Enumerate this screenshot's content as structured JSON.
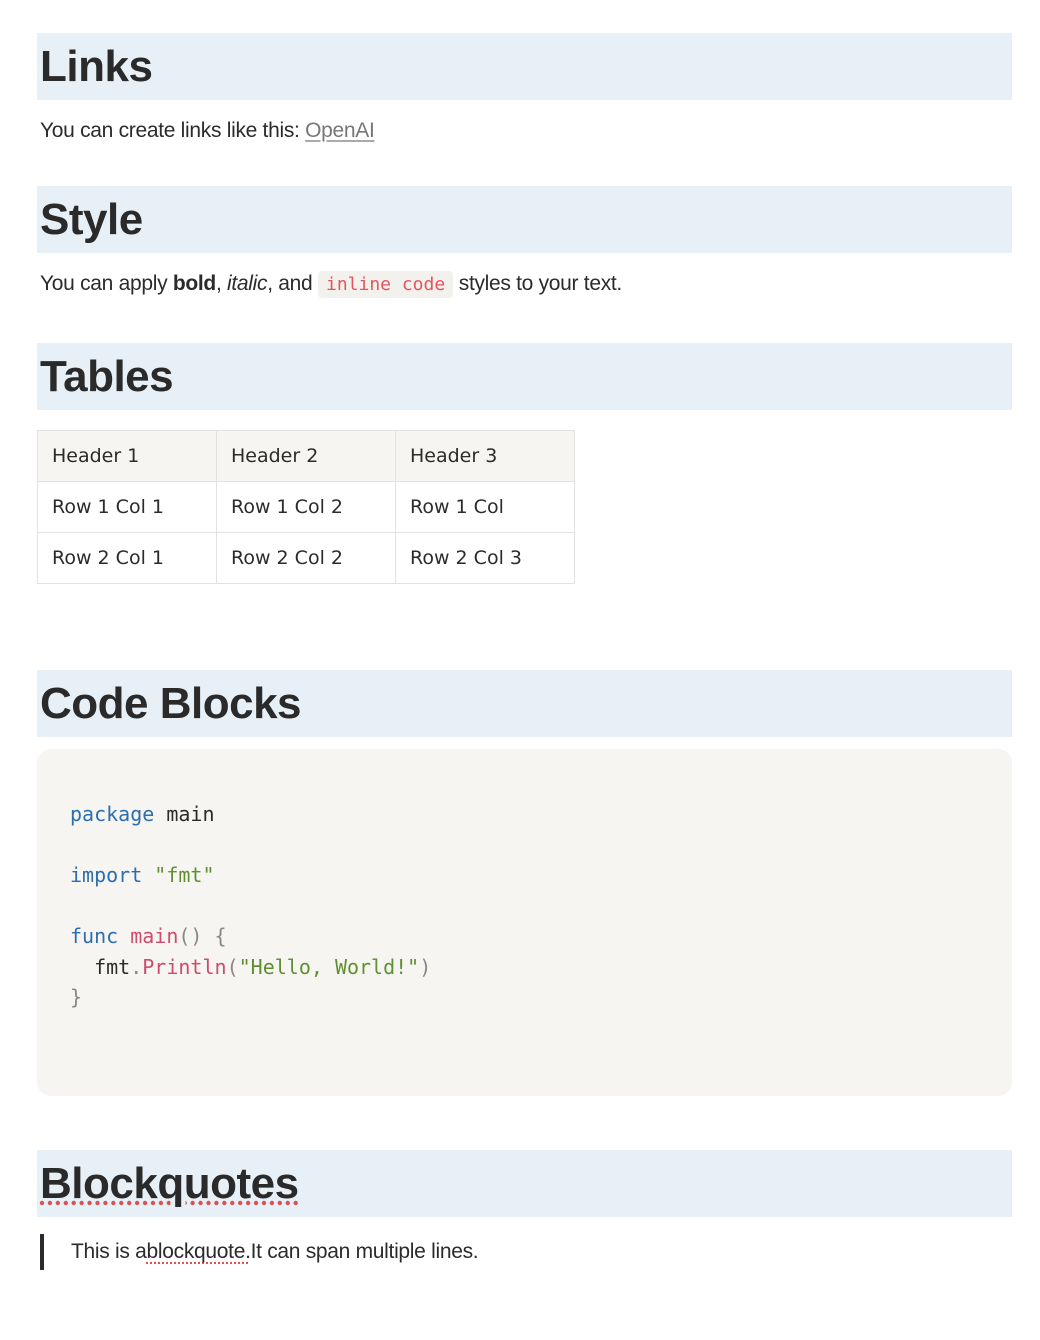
{
  "sections": {
    "links": {
      "heading": "Links",
      "text": "You can create links like this: ",
      "link_label": "OpenAI"
    },
    "style": {
      "heading": "Style",
      "prefix": "You can apply ",
      "bold": "bold",
      "sep1": ", ",
      "italic": "italic",
      "sep2": ", and ",
      "inline_code": "inline code",
      "suffix": " styles to your text."
    },
    "tables": {
      "heading": "Tables",
      "headers": [
        "Header 1",
        "Header 2",
        "Header 3"
      ],
      "rows": [
        [
          "Row 1 Col 1",
          "Row 1 Col 2",
          "Row 1 Col"
        ],
        [
          "Row 2 Col 1",
          "Row 2 Col 2",
          "Row 2 Col 3"
        ]
      ]
    },
    "code_blocks": {
      "heading": "Code Blocks",
      "code": {
        "kw_package": "package",
        "main_name": " main",
        "kw_import": "import",
        "import_str": "\"fmt\"",
        "kw_func": "func",
        "fn_main": "main",
        "parens_open": "() {",
        "indent_fmt": "  fmt",
        "dot": ".",
        "fn_println": "Println",
        "paren_l": "(",
        "hello_str": "\"Hello, World!\"",
        "paren_r": ")",
        "close_brace": "}"
      }
    },
    "blockquotes": {
      "heading": "Blockquotes",
      "prefix": "This is a ",
      "word": "blockquote.",
      "suffix": "It can span multiple lines."
    }
  }
}
